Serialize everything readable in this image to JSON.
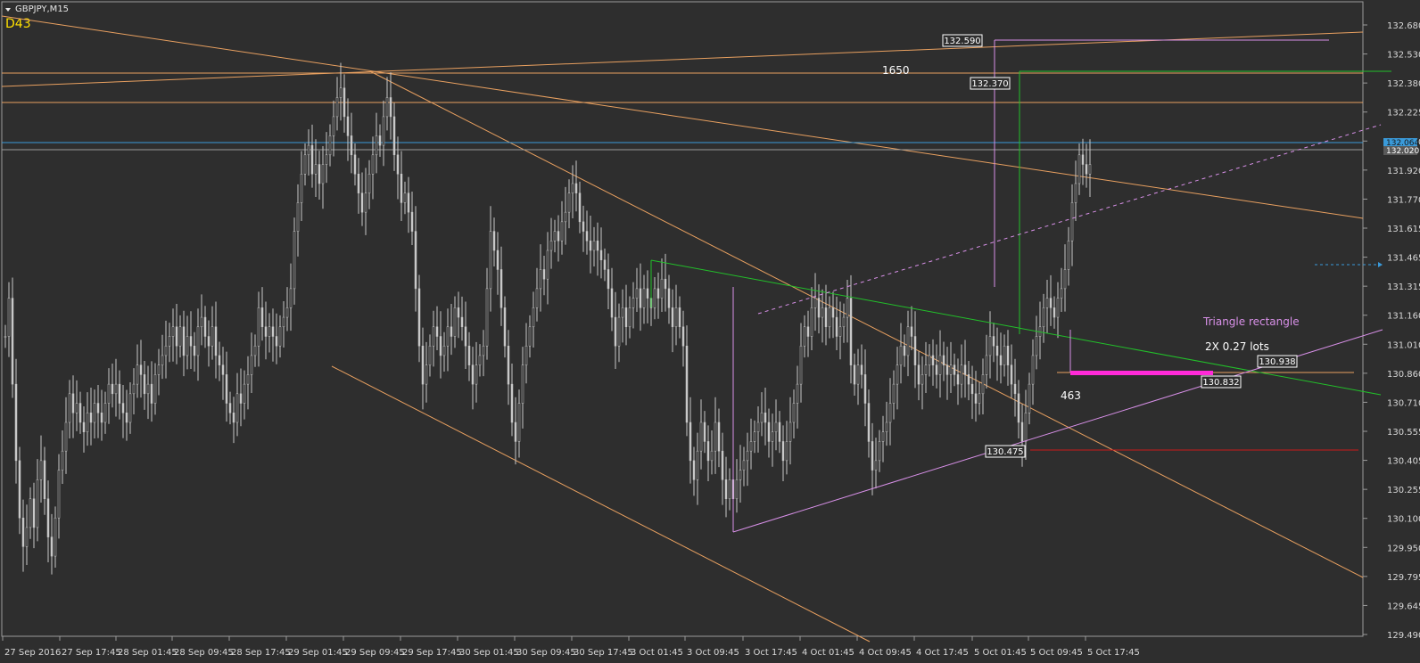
{
  "chart_data": {
    "type": "line",
    "title": "GBPJPY,M15",
    "indicator_text": "D43",
    "y_ticks": [
      "132.680",
      "132.530",
      "132.380",
      "132.225",
      "132.070",
      "131.920",
      "131.770",
      "131.615",
      "131.465",
      "131.315",
      "131.160",
      "131.010",
      "130.860",
      "130.710",
      "130.555",
      "130.405",
      "130.255",
      "130.100",
      "129.950",
      "129.795",
      "129.645",
      "129.490"
    ],
    "y_range": [
      129.49,
      132.68
    ],
    "x_ticks": [
      "27 Sep 2016",
      "27 Sep 17:45",
      "28 Sep 01:45",
      "28 Sep 09:45",
      "28 Sep 17:45",
      "29 Sep 01:45",
      "29 Sep 09:45",
      "29 Sep 17:45",
      "30 Sep 01:45",
      "30 Sep 09:45",
      "30 Sep 17:45",
      "3 Oct 01:45",
      "3 Oct 09:45",
      "3 Oct 17:45",
      "4 Oct 01:45",
      "4 Oct 09:45",
      "4 Oct 17:45",
      "5 Oct 01:45",
      "5 Oct 09:45",
      "5 Oct 17:45"
    ],
    "price_tags": {
      "current": "132.064",
      "bid": "132.020"
    },
    "annotations": {
      "high_box": "132.590",
      "second_box": "132.370",
      "entry_box": "130.938",
      "stop_box": "130.832",
      "low_box": "130.475",
      "pips_1650": "1650",
      "pips_463": "463",
      "pattern_name": "Triangle rectangle",
      "lots": "2X 0.27 lots"
    },
    "price_series": [
      [
        0,
        131.05
      ],
      [
        4,
        131.25
      ],
      [
        8,
        130.8
      ],
      [
        12,
        130.4
      ],
      [
        16,
        130.1
      ],
      [
        20,
        129.95
      ],
      [
        24,
        130.05
      ],
      [
        28,
        130.2
      ],
      [
        32,
        130.05
      ],
      [
        36,
        130.3
      ],
      [
        40,
        130.4
      ],
      [
        44,
        130.2
      ],
      [
        48,
        130.0
      ],
      [
        52,
        129.9
      ],
      [
        56,
        130.1
      ],
      [
        60,
        130.35
      ],
      [
        64,
        130.45
      ],
      [
        68,
        130.6
      ],
      [
        72,
        130.75
      ],
      [
        76,
        130.65
      ],
      [
        80,
        130.7
      ],
      [
        84,
        130.6
      ],
      [
        88,
        130.55
      ],
      [
        92,
        130.65
      ],
      [
        96,
        130.6
      ],
      [
        100,
        130.7
      ],
      [
        104,
        130.65
      ],
      [
        108,
        130.6
      ],
      [
        112,
        130.7
      ],
      [
        116,
        130.8
      ],
      [
        120,
        130.75
      ],
      [
        124,
        130.8
      ],
      [
        128,
        130.7
      ],
      [
        132,
        130.65
      ],
      [
        136,
        130.6
      ],
      [
        140,
        130.75
      ],
      [
        144,
        130.8
      ],
      [
        148,
        130.9
      ],
      [
        152,
        130.85
      ],
      [
        156,
        130.75
      ],
      [
        160,
        130.8
      ],
      [
        164,
        130.7
      ],
      [
        168,
        130.85
      ],
      [
        172,
        130.9
      ],
      [
        176,
        130.95
      ],
      [
        180,
        131.0
      ],
      [
        184,
        131.05
      ],
      [
        188,
        131.1
      ],
      [
        192,
        131.0
      ],
      [
        196,
        131.1
      ],
      [
        200,
        130.95
      ],
      [
        204,
        131.05
      ],
      [
        208,
        131.0
      ],
      [
        212,
        130.95
      ],
      [
        216,
        131.1
      ],
      [
        220,
        131.15
      ],
      [
        224,
        131.05
      ],
      [
        228,
        131.0
      ],
      [
        232,
        131.1
      ],
      [
        236,
        130.95
      ],
      [
        240,
        130.9
      ],
      [
        244,
        130.85
      ],
      [
        248,
        130.7
      ],
      [
        252,
        130.65
      ],
      [
        256,
        130.6
      ],
      [
        260,
        130.75
      ],
      [
        264,
        130.7
      ],
      [
        268,
        130.8
      ],
      [
        272,
        130.85
      ],
      [
        276,
        130.95
      ],
      [
        280,
        131.0
      ],
      [
        284,
        131.2
      ],
      [
        288,
        131.1
      ],
      [
        292,
        131.05
      ],
      [
        296,
        131.1
      ],
      [
        300,
        131.05
      ],
      [
        304,
        131.0
      ],
      [
        308,
        131.1
      ],
      [
        312,
        131.15
      ],
      [
        316,
        131.2
      ],
      [
        320,
        131.3
      ],
      [
        324,
        131.6
      ],
      [
        328,
        131.75
      ],
      [
        332,
        131.9
      ],
      [
        336,
        132.0
      ],
      [
        340,
        132.05
      ],
      [
        344,
        131.9
      ],
      [
        348,
        131.95
      ],
      [
        352,
        131.85
      ],
      [
        356,
        131.95
      ],
      [
        360,
        132.0
      ],
      [
        364,
        132.1
      ],
      [
        368,
        132.2
      ],
      [
        372,
        132.3
      ],
      [
        376,
        132.35
      ],
      [
        380,
        132.2
      ],
      [
        384,
        132.1
      ],
      [
        388,
        132.0
      ],
      [
        392,
        131.9
      ],
      [
        396,
        131.8
      ],
      [
        400,
        131.7
      ],
      [
        404,
        131.8
      ],
      [
        408,
        131.9
      ],
      [
        412,
        132.0
      ],
      [
        416,
        132.1
      ],
      [
        420,
        132.05
      ],
      [
        424,
        132.2
      ],
      [
        428,
        132.3
      ],
      [
        432,
        132.2
      ],
      [
        436,
        132.0
      ],
      [
        440,
        131.9
      ],
      [
        444,
        131.75
      ],
      [
        448,
        131.8
      ],
      [
        452,
        131.7
      ],
      [
        456,
        131.6
      ],
      [
        460,
        131.3
      ],
      [
        464,
        131.0
      ],
      [
        468,
        130.8
      ],
      [
        472,
        130.9
      ],
      [
        476,
        131.0
      ],
      [
        480,
        131.1
      ],
      [
        484,
        131.05
      ],
      [
        488,
        130.95
      ],
      [
        492,
        131.0
      ],
      [
        496,
        131.1
      ],
      [
        500,
        131.05
      ],
      [
        504,
        131.2
      ],
      [
        508,
        131.15
      ],
      [
        512,
        131.1
      ],
      [
        516,
        131.0
      ],
      [
        520,
        130.9
      ],
      [
        524,
        130.8
      ],
      [
        528,
        130.9
      ],
      [
        532,
        130.95
      ],
      [
        536,
        131.0
      ],
      [
        540,
        131.3
      ],
      [
        544,
        131.6
      ],
      [
        548,
        131.5
      ],
      [
        552,
        131.4
      ],
      [
        556,
        131.2
      ],
      [
        560,
        131.0
      ],
      [
        564,
        130.8
      ],
      [
        568,
        130.6
      ],
      [
        572,
        130.5
      ],
      [
        576,
        130.7
      ],
      [
        580,
        130.9
      ],
      [
        584,
        131.0
      ],
      [
        588,
        131.1
      ],
      [
        592,
        131.2
      ],
      [
        596,
        131.3
      ],
      [
        600,
        131.4
      ],
      [
        604,
        131.35
      ],
      [
        608,
        131.5
      ],
      [
        612,
        131.55
      ],
      [
        616,
        131.6
      ],
      [
        620,
        131.55
      ],
      [
        624,
        131.65
      ],
      [
        628,
        131.7
      ],
      [
        632,
        131.8
      ],
      [
        636,
        131.85
      ],
      [
        640,
        131.8
      ],
      [
        644,
        131.65
      ],
      [
        648,
        131.6
      ],
      [
        652,
        131.55
      ],
      [
        656,
        131.5
      ],
      [
        660,
        131.55
      ],
      [
        664,
        131.5
      ],
      [
        668,
        131.45
      ],
      [
        672,
        131.4
      ],
      [
        676,
        131.3
      ],
      [
        680,
        131.15
      ],
      [
        684,
        131.0
      ],
      [
        688,
        131.15
      ],
      [
        692,
        131.2
      ],
      [
        696,
        131.1
      ],
      [
        700,
        131.2
      ],
      [
        704,
        131.25
      ],
      [
        708,
        131.3
      ],
      [
        712,
        131.2
      ],
      [
        716,
        131.3
      ],
      [
        720,
        131.25
      ],
      [
        724,
        131.2
      ],
      [
        728,
        131.3
      ],
      [
        732,
        131.25
      ],
      [
        736,
        131.35
      ],
      [
        740,
        131.3
      ],
      [
        744,
        131.2
      ],
      [
        748,
        131.1
      ],
      [
        752,
        131.2
      ],
      [
        756,
        131.1
      ],
      [
        760,
        131.0
      ],
      [
        764,
        130.6
      ],
      [
        768,
        130.4
      ],
      [
        772,
        130.3
      ],
      [
        776,
        130.45
      ],
      [
        780,
        130.6
      ],
      [
        784,
        130.5
      ],
      [
        788,
        130.4
      ],
      [
        792,
        130.45
      ],
      [
        796,
        130.6
      ],
      [
        800,
        130.45
      ],
      [
        804,
        130.3
      ],
      [
        808,
        130.2
      ],
      [
        812,
        130.3
      ],
      [
        816,
        130.2
      ],
      [
        820,
        130.3
      ],
      [
        824,
        130.35
      ],
      [
        828,
        130.4
      ],
      [
        832,
        130.45
      ],
      [
        836,
        130.5
      ],
      [
        840,
        130.55
      ],
      [
        844,
        130.6
      ],
      [
        848,
        130.65
      ],
      [
        852,
        130.6
      ],
      [
        856,
        130.5
      ],
      [
        860,
        130.55
      ],
      [
        864,
        130.6
      ],
      [
        868,
        130.5
      ],
      [
        872,
        130.4
      ],
      [
        876,
        130.5
      ],
      [
        880,
        130.6
      ],
      [
        884,
        130.7
      ],
      [
        888,
        130.8
      ],
      [
        892,
        131.0
      ],
      [
        896,
        131.1
      ],
      [
        900,
        131.05
      ],
      [
        904,
        131.2
      ],
      [
        908,
        131.25
      ],
      [
        912,
        131.15
      ],
      [
        916,
        131.2
      ],
      [
        920,
        131.1
      ],
      [
        924,
        131.2
      ],
      [
        928,
        131.15
      ],
      [
        932,
        131.05
      ],
      [
        936,
        131.1
      ],
      [
        940,
        131.15
      ],
      [
        944,
        131.25
      ],
      [
        948,
        130.9
      ],
      [
        952,
        130.8
      ],
      [
        956,
        130.9
      ],
      [
        960,
        130.85
      ],
      [
        964,
        130.7
      ],
      [
        968,
        130.5
      ],
      [
        972,
        130.35
      ],
      [
        976,
        130.4
      ],
      [
        980,
        130.5
      ],
      [
        984,
        130.55
      ],
      [
        988,
        130.6
      ],
      [
        992,
        130.7
      ],
      [
        996,
        130.8
      ],
      [
        1000,
        130.9
      ],
      [
        1004,
        131.0
      ],
      [
        1008,
        130.95
      ],
      [
        1012,
        131.1
      ],
      [
        1016,
        131.05
      ],
      [
        1020,
        130.9
      ],
      [
        1024,
        130.8
      ],
      [
        1028,
        130.85
      ],
      [
        1032,
        130.9
      ],
      [
        1036,
        130.95
      ],
      [
        1040,
        130.9
      ],
      [
        1044,
        130.85
      ],
      [
        1048,
        130.95
      ],
      [
        1052,
        130.9
      ],
      [
        1056,
        130.85
      ],
      [
        1060,
        130.9
      ],
      [
        1064,
        130.85
      ],
      [
        1068,
        130.8
      ],
      [
        1072,
        130.9
      ],
      [
        1076,
        130.85
      ],
      [
        1080,
        130.8
      ],
      [
        1084,
        130.75
      ],
      [
        1088,
        130.7
      ],
      [
        1092,
        130.75
      ],
      [
        1096,
        130.85
      ],
      [
        1100,
        130.95
      ],
      [
        1104,
        131.05
      ],
      [
        1108,
        131.0
      ],
      [
        1112,
        130.95
      ],
      [
        1116,
        130.9
      ],
      [
        1120,
        131.0
      ],
      [
        1124,
        130.9
      ],
      [
        1128,
        130.8
      ],
      [
        1132,
        130.75
      ],
      [
        1136,
        130.6
      ],
      [
        1140,
        130.5
      ],
      [
        1144,
        130.65
      ],
      [
        1148,
        130.8
      ],
      [
        1152,
        130.95
      ],
      [
        1156,
        131.05
      ],
      [
        1160,
        131.1
      ],
      [
        1164,
        131.2
      ],
      [
        1168,
        131.25
      ],
      [
        1172,
        131.2
      ],
      [
        1176,
        131.15
      ],
      [
        1180,
        131.25
      ],
      [
        1184,
        131.3
      ],
      [
        1188,
        131.4
      ],
      [
        1192,
        131.55
      ],
      [
        1196,
        131.75
      ],
      [
        1200,
        131.85
      ],
      [
        1204,
        132.0
      ],
      [
        1208,
        131.95
      ],
      [
        1212,
        131.9
      ],
      [
        1216,
        131.95
      ]
    ]
  },
  "colors": {
    "background": "#2e2e2e",
    "candle": "#c8c8c8",
    "orange": "#e8a060",
    "blue": "#3a9ad9",
    "green": "#22c02a",
    "violet": "#d890e8",
    "magenta": "#ff2ad8",
    "red": "#cc1a1a",
    "axis_text": "#d8d8d8",
    "indicator": "#ffe000"
  }
}
